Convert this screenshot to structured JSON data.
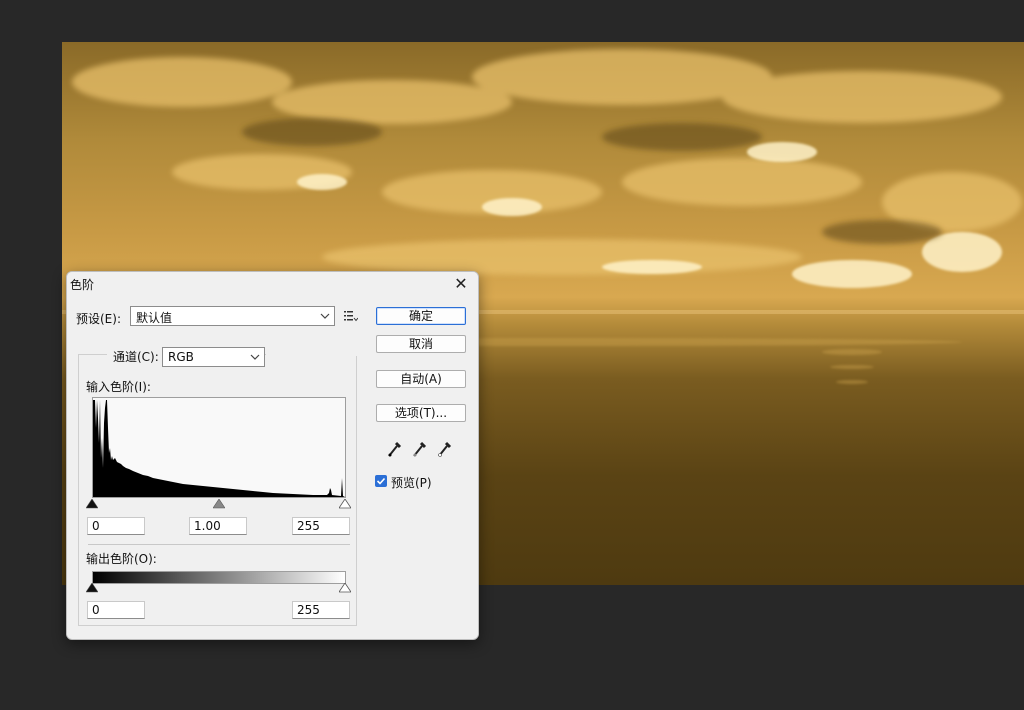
{
  "dialog": {
    "title": "色阶",
    "preset_label": "预设(E):",
    "preset_value": "默认值",
    "channel_label": "通道(C):",
    "channel_value": "RGB",
    "input_levels_label": "输入色阶(I):",
    "output_levels_label": "输出色阶(O):",
    "input_black": "0",
    "input_gamma": "1.00",
    "input_white": "255",
    "output_black": "0",
    "output_white": "255",
    "buttons": {
      "ok": "确定",
      "cancel": "取消",
      "auto": "自动(A)",
      "options": "选项(T)..."
    },
    "preview_label": "预览(P)",
    "preview_checked": true
  },
  "colors": {
    "accent": "#2b6fd6",
    "app_background": "#282828",
    "image_gold": "#c89a45"
  },
  "icons": [
    "close-icon",
    "chevron-down-icon",
    "preset-menu-icon",
    "black-eyedropper-icon",
    "gray-eyedropper-icon",
    "white-eyedropper-icon",
    "checkmark-icon"
  ]
}
